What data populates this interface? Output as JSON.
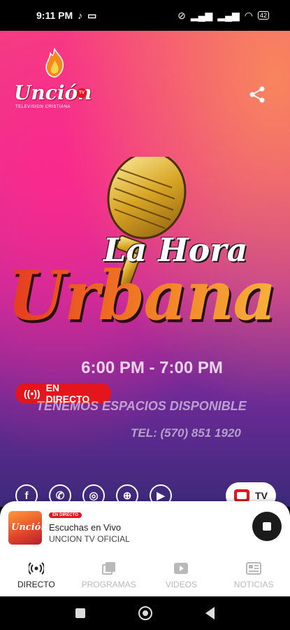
{
  "status": {
    "time": "9:11 PM",
    "battery": "42"
  },
  "brand": {
    "logo_text": "Unción",
    "logo_sub": "TELEVISION CRISTIANA",
    "logo_badge": "TV"
  },
  "hero": {
    "title_line1": "La Hora",
    "title_line2": "Urbana",
    "schedule": "6:00 PM - 7:00 PM",
    "live_label": "EN DIRECTO",
    "spaces": "TENEMOS ESPACIOS DISPONIBLE",
    "tel": "TEL: (570) 851 1920"
  },
  "tv_button": {
    "label": "TV"
  },
  "player": {
    "badge": "EN DIRECTO",
    "title": "Escuchas en Vivo",
    "subtitle": "UNCION TV OFICIAL",
    "thumb_text": "Unción"
  },
  "tabs": [
    {
      "label": "DIRECTO",
      "active": true
    },
    {
      "label": "PROGRAMAS",
      "active": false
    },
    {
      "label": "VIDEOS",
      "active": false
    },
    {
      "label": "NOTICIAS",
      "active": false
    }
  ],
  "colors": {
    "accent": "#e4151d",
    "tab_inactive": "#b9b9b9"
  }
}
